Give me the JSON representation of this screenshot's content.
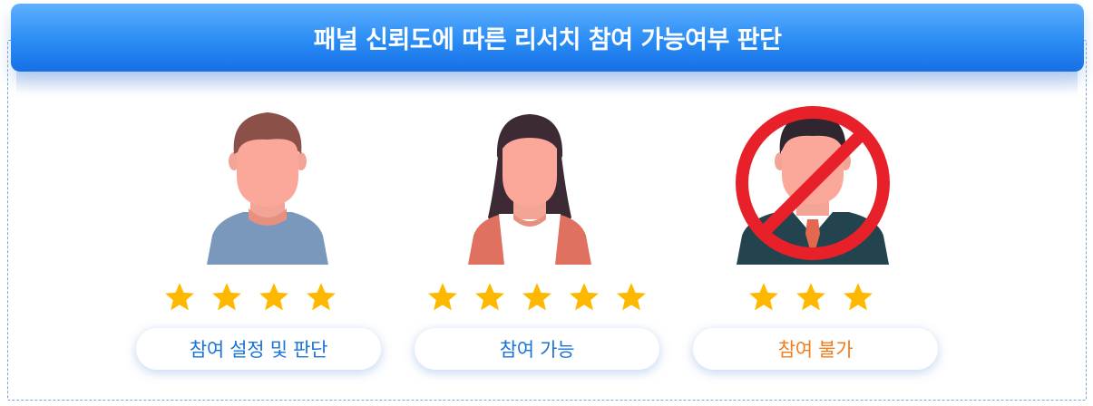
{
  "header": {
    "title": "패널 신뢰도에 따른 리서치 참여 가능여부 판단"
  },
  "panels": [
    {
      "label": "참여 설정 및 판단",
      "stars": 4,
      "label_color": "#1a73d9"
    },
    {
      "label": "참여 가능",
      "stars": 5,
      "label_color": "#1a73d9"
    },
    {
      "label": "참여 불가",
      "stars": 3,
      "label_color": "#f07d1e",
      "prohibited": true
    }
  ],
  "colors": {
    "star": "#ffb800",
    "prohibit": "#e8202a",
    "header": "#2a8cf4"
  }
}
